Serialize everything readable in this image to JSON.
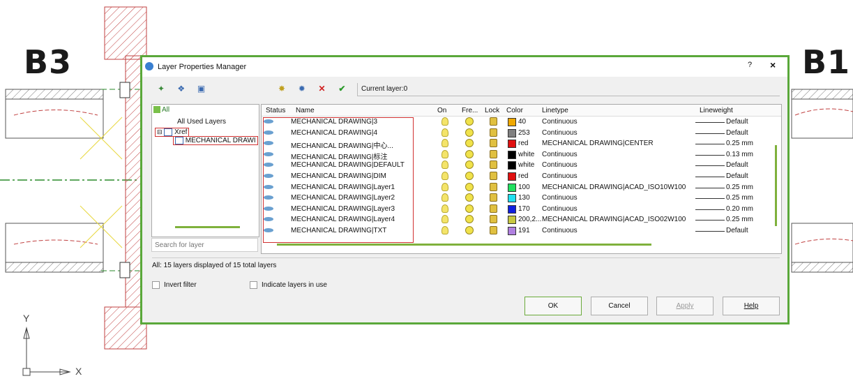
{
  "background": {
    "left_label": "B3",
    "right_label": "B1",
    "axis_y": "Y",
    "axis_x": "X"
  },
  "dialog": {
    "title": "Layer Properties Manager",
    "help": "?",
    "close": "×",
    "current_layer": "Current layer:0",
    "tree": {
      "all": "All",
      "all_used": "All Used Layers",
      "xref": "Xref",
      "xref_child": "MECHANICAL DRAWI"
    },
    "search_placeholder": "Search for layer",
    "columns": {
      "status": "Status",
      "name": "Name",
      "on": "On",
      "freeze": "Fre...",
      "lock": "Lock",
      "color": "Color",
      "linetype": "Linetype",
      "lineweight": "Lineweight"
    },
    "layers": [
      {
        "name": "MECHANICAL DRAWING|3",
        "color_name": "40",
        "color_hex": "#f0a800",
        "linetype": "Continuous",
        "lineweight": "Default"
      },
      {
        "name": "MECHANICAL DRAWING|4",
        "color_name": "253",
        "color_hex": "#808080",
        "linetype": "Continuous",
        "lineweight": "Default"
      },
      {
        "name": "MECHANICAL DRAWING|中心...",
        "color_name": "red",
        "color_hex": "#e01010",
        "linetype": "MECHANICAL DRAWING|CENTER",
        "lineweight": "0.25 mm"
      },
      {
        "name": "MECHANICAL DRAWING|标注",
        "color_name": "white",
        "color_hex": "#000000",
        "linetype": "Continuous",
        "lineweight": "0.13 mm"
      },
      {
        "name": "MECHANICAL DRAWING|DEFAULT",
        "color_name": "white",
        "color_hex": "#000000",
        "linetype": "Continuous",
        "lineweight": "Default"
      },
      {
        "name": "MECHANICAL DRAWING|DIM",
        "color_name": "red",
        "color_hex": "#e01010",
        "linetype": "Continuous",
        "lineweight": "Default"
      },
      {
        "name": "MECHANICAL DRAWING|Layer1",
        "color_name": "100",
        "color_hex": "#20e060",
        "linetype": "MECHANICAL DRAWING|ACAD_ISO10W100",
        "lineweight": "0.25 mm"
      },
      {
        "name": "MECHANICAL DRAWING|Layer2",
        "color_name": "130",
        "color_hex": "#20e0f0",
        "linetype": "Continuous",
        "lineweight": "0.25 mm"
      },
      {
        "name": "MECHANICAL DRAWING|Layer3",
        "color_name": "170",
        "color_hex": "#1020e0",
        "linetype": "Continuous",
        "lineweight": "0.20 mm"
      },
      {
        "name": "MECHANICAL DRAWING|Layer4",
        "color_name": "200,2...",
        "color_hex": "#c8c840",
        "linetype": "MECHANICAL DRAWING|ACAD_ISO02W100",
        "lineweight": "0.25 mm"
      },
      {
        "name": "MECHANICAL DRAWING|TXT",
        "color_name": "191",
        "color_hex": "#b080e0",
        "linetype": "Continuous",
        "lineweight": "Default"
      }
    ],
    "status_text": "All: 15 layers displayed of 15 total layers",
    "invert_filter": "Invert filter",
    "indicate_layers": "Indicate layers in use",
    "buttons": {
      "ok": "OK",
      "cancel": "Cancel",
      "apply": "Apply",
      "help": "Help"
    }
  }
}
